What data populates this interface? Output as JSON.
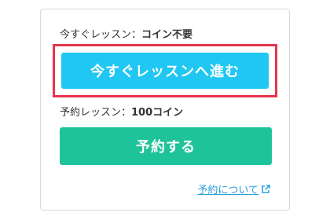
{
  "instant": {
    "label": "今すぐレッスン：",
    "value": "コイン不要",
    "button_label": "今すぐレッスンへ進む"
  },
  "reserve": {
    "label": "予約レッスン：",
    "value": "100コイン",
    "button_label": "予約する"
  },
  "about_link": {
    "text": "予約について",
    "icon": "external-link-icon"
  },
  "colors": {
    "instant_button": "#1fc7f2",
    "reserve_button": "#1fc39a",
    "focus_ring": "#e8344e",
    "link": "#2a9ed8"
  }
}
